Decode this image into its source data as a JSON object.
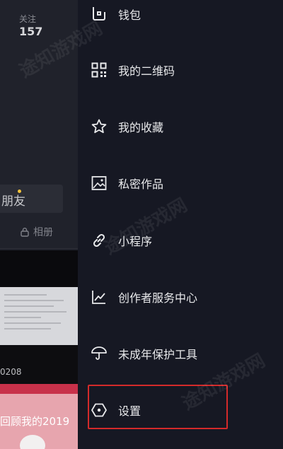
{
  "profile": {
    "follow_label": "关注",
    "follow_count": "157",
    "friends_button": "朋友",
    "album_label": "相册",
    "video_date_text": "0208",
    "video_banner_text": "回顾我的2019"
  },
  "menu": {
    "items": [
      {
        "label": "钱包",
        "icon": "wallet-icon"
      },
      {
        "label": "我的二维码",
        "icon": "qr-code-icon"
      },
      {
        "label": "我的收藏",
        "icon": "star-icon"
      },
      {
        "label": "私密作品",
        "icon": "private-image-icon"
      },
      {
        "label": "小程序",
        "icon": "link-icon"
      },
      {
        "label": "创作者服务中心",
        "icon": "chart-icon"
      },
      {
        "label": "未成年保护工具",
        "icon": "umbrella-icon"
      },
      {
        "label": "设置",
        "icon": "hexagon-settings-icon"
      }
    ]
  },
  "watermark": "途知游戏网",
  "colors": {
    "background": "#161823",
    "highlight": "#d42a2a",
    "badge": "#f3c33b"
  }
}
